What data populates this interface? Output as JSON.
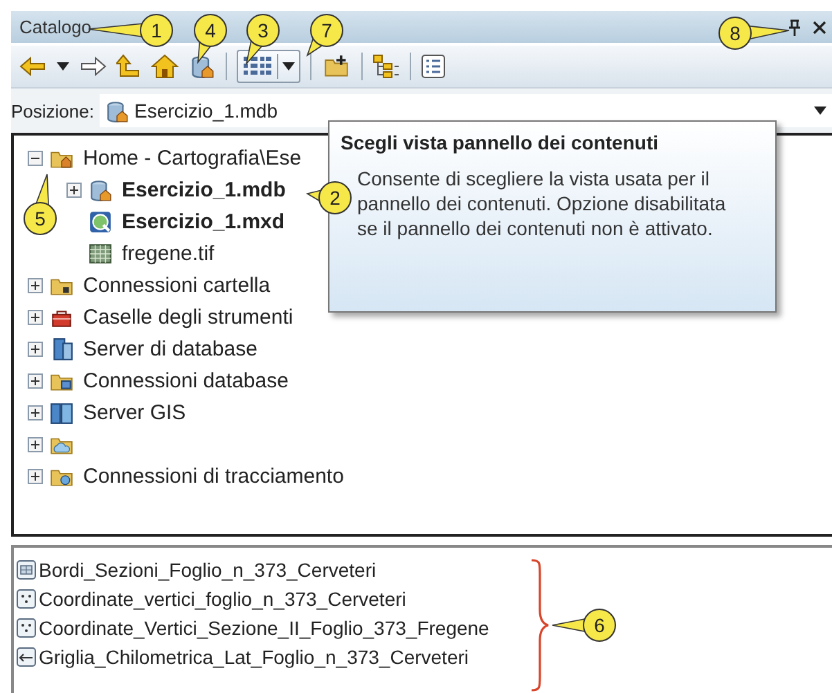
{
  "panel": {
    "title": "Catalogo"
  },
  "location": {
    "label": "Posizione:",
    "value": "Esercizio_1.mdb"
  },
  "tree": [
    {
      "label": "Home - Cartografia\\Ese",
      "kind": "home-folder",
      "expanded": true,
      "children": [
        {
          "label": "Esercizio_1.mdb",
          "kind": "database",
          "bold": true,
          "expanded": false
        },
        {
          "label": "Esercizio_1.mxd",
          "kind": "map-document",
          "bold": true
        },
        {
          "label": "fregene.tif",
          "kind": "raster"
        }
      ]
    },
    {
      "label": "Connessioni cartella",
      "kind": "folder-connection",
      "expanded": false
    },
    {
      "label": "Caselle degli strumenti",
      "kind": "toolbox",
      "expanded": false
    },
    {
      "label": "Server di database",
      "kind": "database-server",
      "expanded": false
    },
    {
      "label": "Connessioni database",
      "kind": "database-connection",
      "expanded": false
    },
    {
      "label": "Server GIS",
      "kind": "gis-server",
      "expanded": false
    },
    {
      "kind": "cloud-folder",
      "expanded": false
    },
    {
      "label": "Connessioni di tracciamento",
      "kind": "tracking-folder",
      "expanded": false
    }
  ],
  "tooltip": {
    "title": "Scegli vista pannello dei contenuti",
    "text": "Consente di scegliere la vista usata per il pannello dei contenuti. Opzione disabilitata se il pannello dei contenuti non è attivato."
  },
  "layers": [
    {
      "name": "Bordi_Sezioni_Foglio_n_373_Cerveteri",
      "kind": "polygon"
    },
    {
      "name": "Coordinate_vertici_foglio_n_373_Cerveteri",
      "kind": "point"
    },
    {
      "name": "Coordinate_Vertici_Sezione_II_Foglio_373_Fregene",
      "kind": "point"
    },
    {
      "name": "Griglia_Chilometrica_Lat_Foglio_n_373_Cerveteri",
      "kind": "line"
    }
  ],
  "callouts": [
    "1",
    "4",
    "3",
    "7",
    "8",
    "5",
    "2",
    "6"
  ]
}
